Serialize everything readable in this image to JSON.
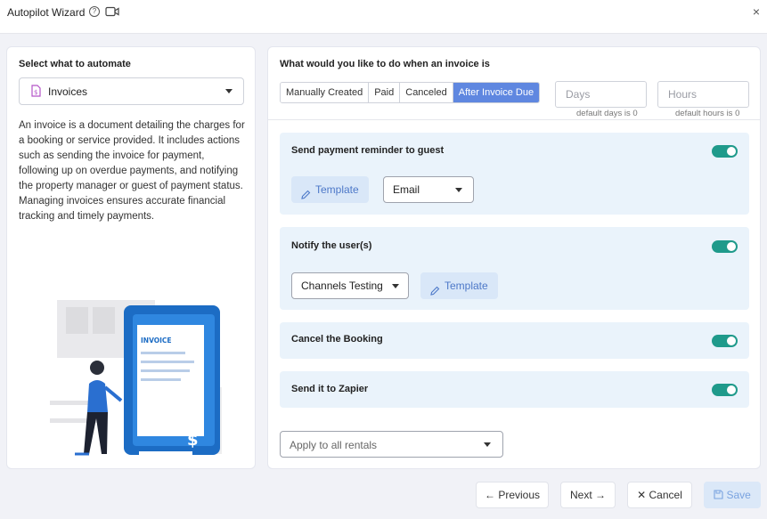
{
  "window": {
    "title": "Autopilot Wizard",
    "close_label": "×"
  },
  "left": {
    "heading": "Select what to automate",
    "selected_object": "Invoices",
    "description": "An invoice is a document detailing the charges for a booking or service provided. It includes actions such as sending the invoice for payment, following up on overdue payments, and notifying the property manager or guest of payment status. Managing invoices ensures accurate financial tracking and timely payments.",
    "illustration_label": "INVOICE",
    "illustration_symbol": "$"
  },
  "right": {
    "question": "What would you like to do when an invoice is",
    "triggers": [
      "Manually Created",
      "Paid",
      "Canceled",
      "After Invoice Due"
    ],
    "active_trigger": "After Invoice Due",
    "days_placeholder": "Days",
    "hours_placeholder": "Hours",
    "days_hint": "default days is 0",
    "hours_hint": "default hours is 0",
    "actions": [
      {
        "title": "Send payment reminder to guest",
        "enabled": true,
        "template_label": "Template",
        "channel": "Email"
      },
      {
        "title": "Notify the user(s)",
        "enabled": true,
        "template_label": "Template",
        "channel": "Channels Testing"
      },
      {
        "title": "Cancel the Booking",
        "enabled": true
      },
      {
        "title": "Send it to Zapier",
        "enabled": true
      }
    ],
    "apply_placeholder": "Apply to all rentals"
  },
  "footer": {
    "previous_label": "← Previous",
    "next_label": "Next →",
    "cancel_label": "✕ Cancel",
    "save_label": "Save"
  },
  "colors": {
    "accent": "#5f87e0",
    "toggle_on": "#1f9a8b",
    "card_bg": "#eaf3fb",
    "template_text": "#4d78c8"
  }
}
